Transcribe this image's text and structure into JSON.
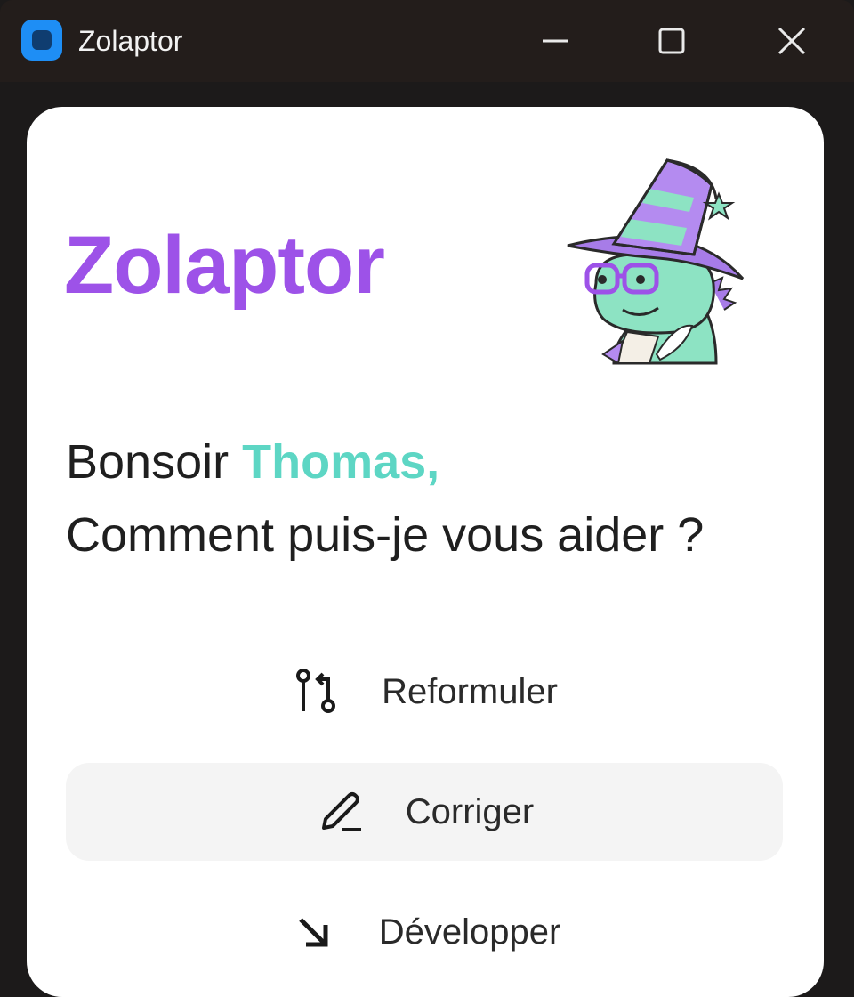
{
  "window": {
    "title": "Zolaptor",
    "controls": [
      "minimize-icon",
      "maximize-icon",
      "close-icon"
    ]
  },
  "header": {
    "brand": "Zolaptor",
    "mascot": "wizard-dinosaur-mascot"
  },
  "greeting": {
    "salutation": "Bonsoir",
    "user_name": "Thomas,",
    "question": "Comment puis-je vous aider ?"
  },
  "actions": [
    {
      "label": "Reformuler",
      "icon": "git-branch-icon",
      "highlighted": false
    },
    {
      "label": "Corriger",
      "icon": "pencil-icon",
      "highlighted": true
    },
    {
      "label": "Développer",
      "icon": "arrow-down-right-icon",
      "highlighted": false
    }
  ],
  "colors": {
    "brand": "#9d52e8",
    "user_name": "#5dd6c4",
    "app_icon": "#1e8ef5",
    "titlebar": "#231d1b",
    "highlight": "#f4f4f4"
  }
}
